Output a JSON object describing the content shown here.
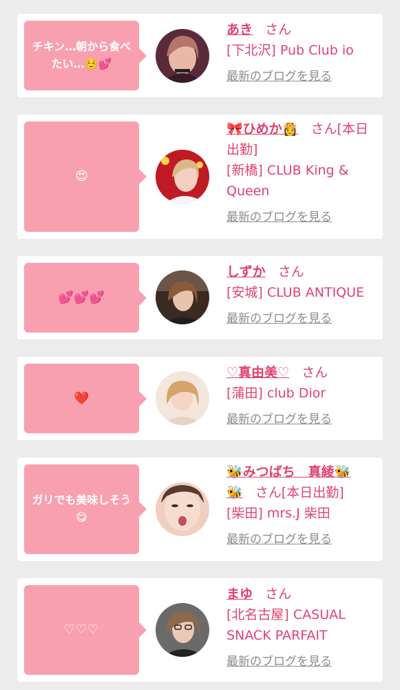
{
  "blog_link_label": "最新のブログを見る",
  "honorific": "さん",
  "entries": [
    {
      "bubble": "チキン…朝から食べたい…☺️💕",
      "name": "あき",
      "suffix": "さん",
      "shop": "[下北沢] Pub Club io"
    },
    {
      "bubble": "😍",
      "name": "🎀ひめか👸",
      "suffix": "さん[本日出勤]",
      "shop": "[新橋] CLUB King & Queen"
    },
    {
      "bubble": "💕💕💕",
      "name": "しずか",
      "suffix": "さん",
      "shop": "[安城] CLUB ANTIQUE"
    },
    {
      "bubble": "❤️",
      "name": "♡真由美♡",
      "suffix": "さん",
      "shop": "[蒲田] club Dior"
    },
    {
      "bubble": "ガリでも美味しそう😋",
      "name": "🐝みつばち　真綾🐝🐝",
      "suffix": "さん[本日出勤]",
      "shop": "[柴田] mrs.J 柴田"
    },
    {
      "bubble": "♡♡♡",
      "name": "まゆ",
      "suffix": "さん",
      "shop": "[北名古屋] CASUAL SNACK PARFAIT"
    }
  ]
}
